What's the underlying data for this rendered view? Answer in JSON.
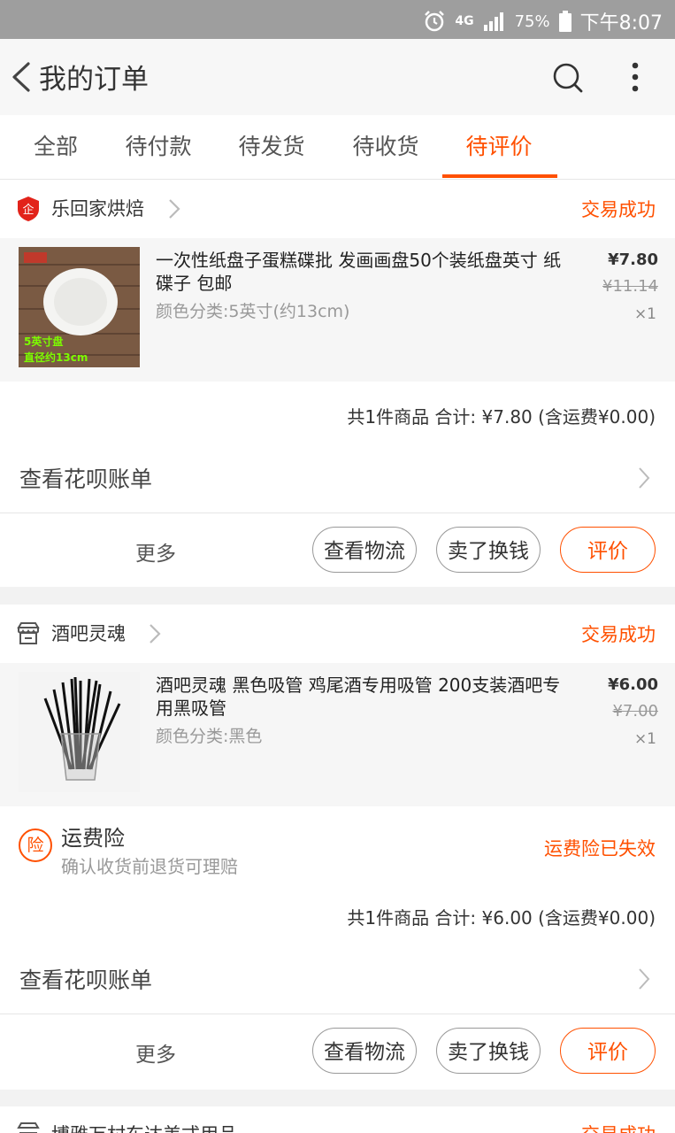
{
  "status_bar": {
    "network": "4G",
    "battery": "75%",
    "time": "下午8:07"
  },
  "header": {
    "title": "我的订单"
  },
  "tabs": [
    "全部",
    "待付款",
    "待发货",
    "待收货",
    "待评价"
  ],
  "active_tab": "待评价",
  "orders": [
    {
      "shop_name": "乐回家烘焙",
      "status": "交易成功",
      "item": {
        "title": "一次性纸盘子蛋糕碟批 发画画盘50个装纸盘英寸 纸碟子 包邮",
        "sku": "颜色分类:5英寸(约13cm)",
        "price": "¥7.80",
        "original_price": "¥11.14",
        "quantity": "×1",
        "thumb_caption_1": "5英寸盘",
        "thumb_caption_2": "直径约13cm"
      },
      "total": "共1件商品  合计: ¥7.80 (含运费¥0.00)",
      "bill_label": "查看花呗账单",
      "more_label": "更多",
      "buttons": {
        "logistics": "查看物流",
        "resell": "卖了换钱",
        "review": "评价"
      }
    },
    {
      "shop_name": "酒吧灵魂",
      "status": "交易成功",
      "item": {
        "title": "酒吧灵魂 黑色吸管 鸡尾酒专用吸管 200支装酒吧专用黑吸管",
        "sku": "颜色分类:黑色",
        "price": "¥6.00",
        "original_price": "¥7.00",
        "quantity": "×1"
      },
      "insurance": {
        "icon_text": "险",
        "title": "运费险",
        "subtitle": "确认收货前退货可理赔",
        "status": "运费险已失效"
      },
      "total": "共1件商品  合计: ¥6.00 (含运费¥0.00)",
      "bill_label": "查看花呗账单",
      "more_label": "更多",
      "buttons": {
        "logistics": "查看物流",
        "resell": "卖了换钱",
        "review": "评价"
      }
    }
  ],
  "partial_order": {
    "shop_name": "博雅万村东达美式用品",
    "status": "交易成功"
  }
}
